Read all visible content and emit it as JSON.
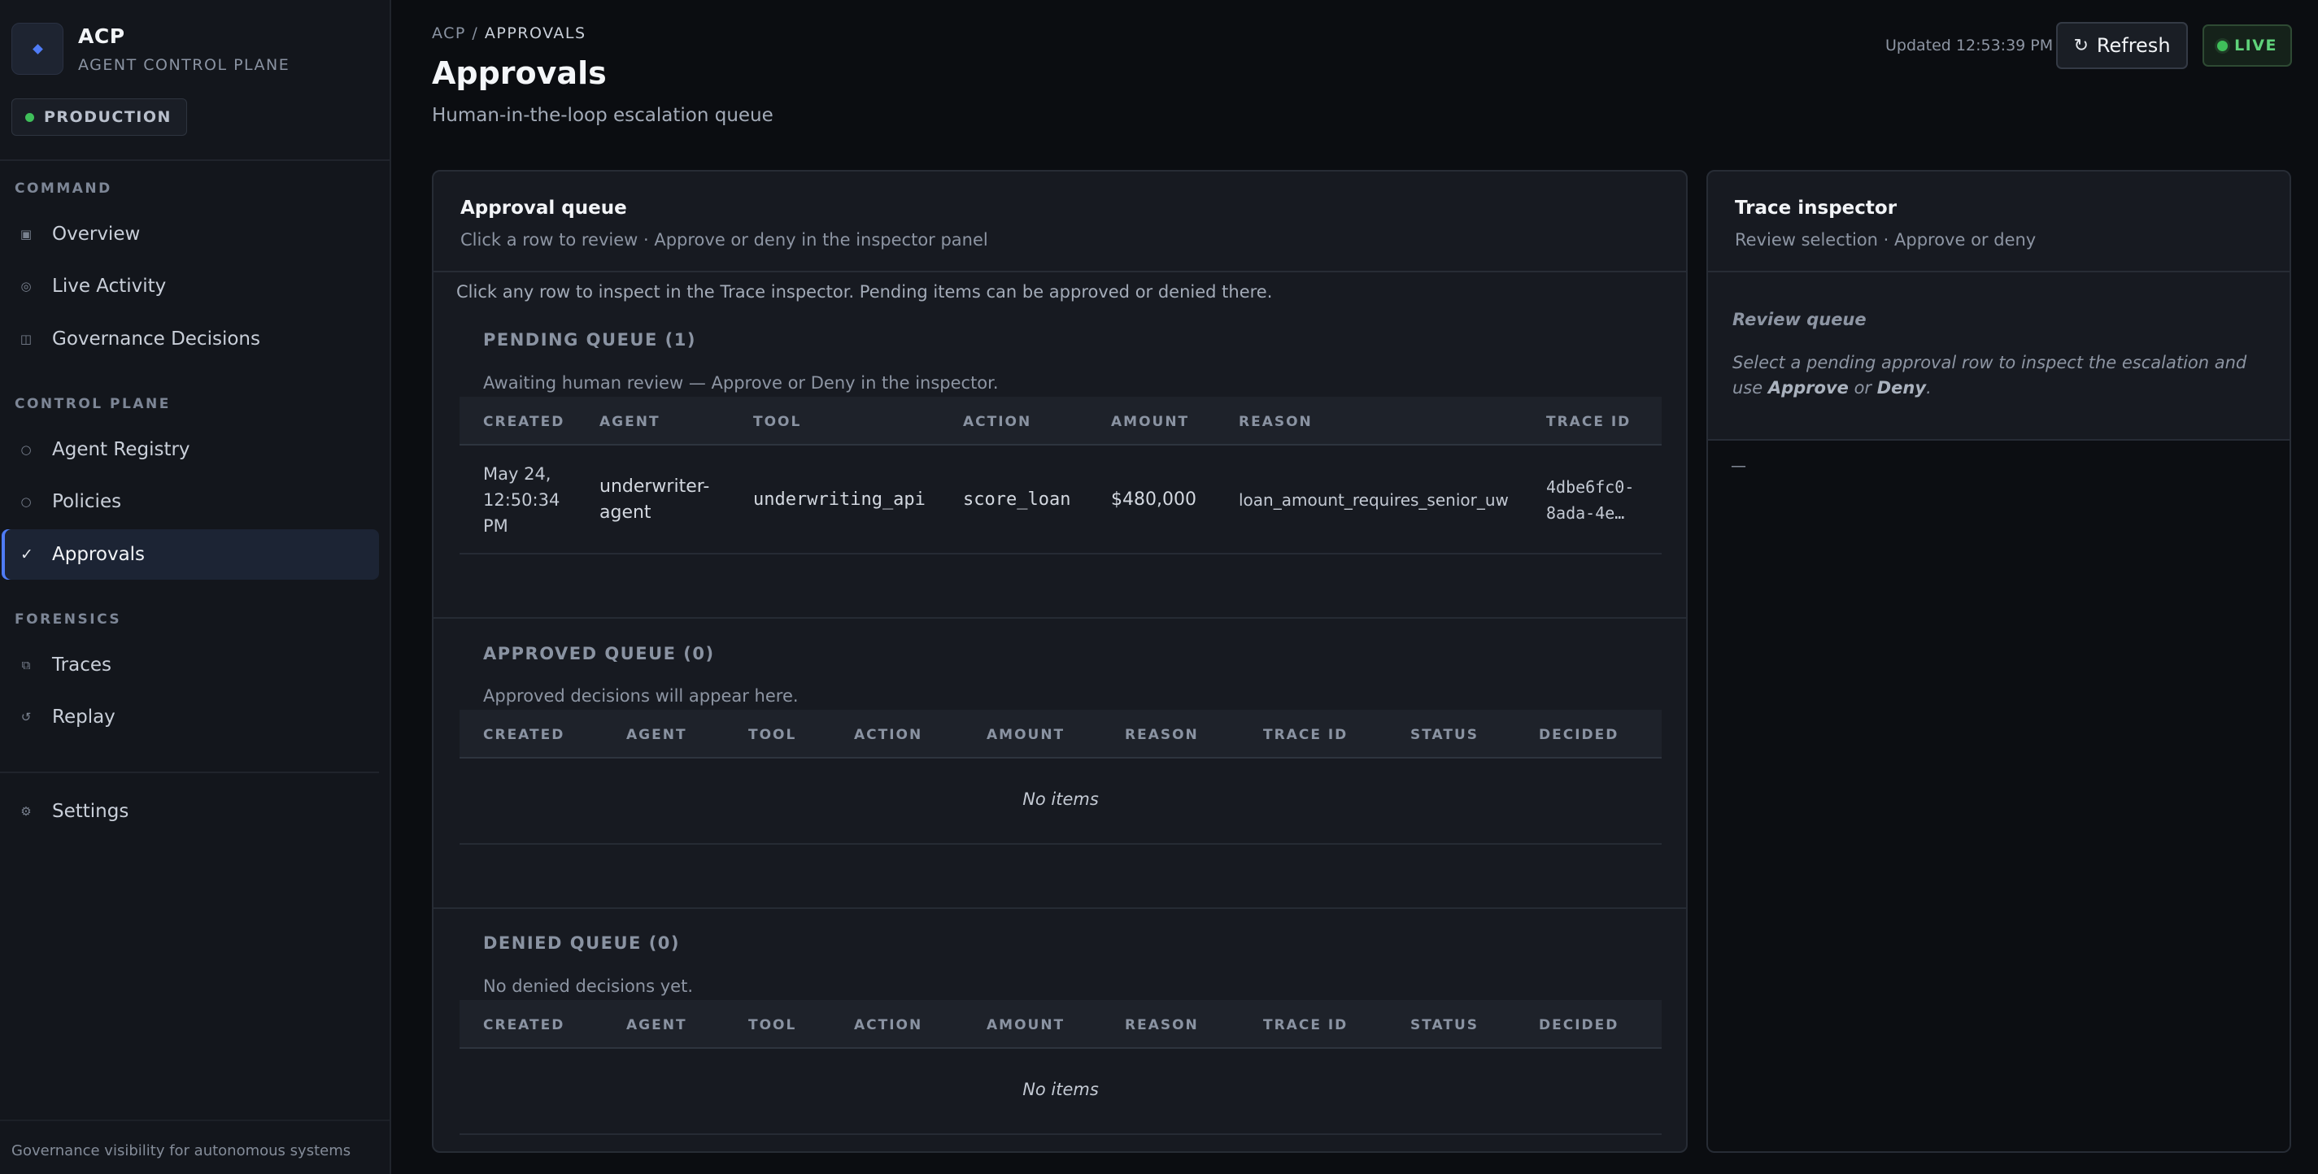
{
  "sidebar": {
    "brand_name": "ACP",
    "brand_subtitle": "AGENT CONTROL PLANE",
    "environment": "PRODUCTION",
    "sections": {
      "command": "COMMAND",
      "control_plane": "CONTROL PLANE",
      "forensics": "FORENSICS"
    },
    "items": {
      "overview": "Overview",
      "live_activity": "Live Activity",
      "governance_decisions": "Governance Decisions",
      "agent_registry": "Agent Registry",
      "policies": "Policies",
      "approvals": "Approvals",
      "traces": "Traces",
      "replay": "Replay",
      "settings": "Settings"
    },
    "active_item": "Approvals",
    "footer": "Governance visibility for autonomous systems"
  },
  "header": {
    "breadcrumb_root": "ACP",
    "breadcrumb_sep": " / ",
    "breadcrumb_current": "APPROVALS",
    "title": "Approvals",
    "subtitle": "Human-in-the-loop escalation queue",
    "updated": "Updated 12:53:39 PM",
    "refresh_label": "Refresh",
    "live_label": "LIVE"
  },
  "queue_panel": {
    "title": "Approval queue",
    "subtitle": "Click a row to review · Approve or deny in the inspector panel",
    "hint": "Click any row to inspect in the Trace inspector. Pending items can be approved or denied there.",
    "pending": {
      "title": "PENDING QUEUE (1)",
      "description": "Awaiting human review — Approve or Deny in the inspector.",
      "columns": [
        "CREATED",
        "AGENT",
        "TOOL",
        "ACTION",
        "AMOUNT",
        "REASON",
        "TRACE ID"
      ],
      "rows": [
        {
          "created_line1": "May 24,",
          "created_line2": "12:50:34",
          "created_line3": "PM",
          "agent_line1": "underwriter-",
          "agent_line2": "agent",
          "tool": "underwriting_api",
          "action": "score_loan",
          "amount": "$480,000",
          "reason": "loan_amount_requires_senior_uw",
          "trace_line1": "4dbe6fc0-",
          "trace_line2": "8ada-4e…"
        }
      ]
    },
    "approved": {
      "title": "APPROVED QUEUE (0)",
      "description": "Approved decisions will appear here.",
      "columns": [
        "CREATED",
        "AGENT",
        "TOOL",
        "ACTION",
        "AMOUNT",
        "REASON",
        "TRACE ID",
        "STATUS",
        "DECIDED"
      ],
      "empty": "No items"
    },
    "denied": {
      "title": "DENIED QUEUE (0)",
      "description": "No denied decisions yet.",
      "columns": [
        "CREATED",
        "AGENT",
        "TOOL",
        "ACTION",
        "AMOUNT",
        "REASON",
        "TRACE ID",
        "STATUS",
        "DECIDED"
      ],
      "empty": "No items"
    }
  },
  "trace_panel": {
    "title": "Trace inspector",
    "subtitle": "Review selection · Approve or deny",
    "review_heading": "Review queue",
    "review_text_1": "Select a pending approval row to inspect the escalation and use ",
    "review_approve": "Approve",
    "review_or": " or ",
    "review_deny": "Deny",
    "review_end": ".",
    "placeholder": "—"
  },
  "colors": {
    "accent": "#4f7cf7",
    "live_green": "#3fbf5a",
    "background": "#0b0d11",
    "panel": "#171a21"
  },
  "icons": {
    "overview": "square-icon",
    "live_activity": "radio-icon",
    "governance_decisions": "columns-icon",
    "agent_registry": "circle-icon",
    "policies": "circle-icon",
    "approvals": "check-icon",
    "traces": "layers-icon",
    "replay": "rotate-icon",
    "settings": "gear-icon",
    "refresh": "refresh-icon"
  }
}
